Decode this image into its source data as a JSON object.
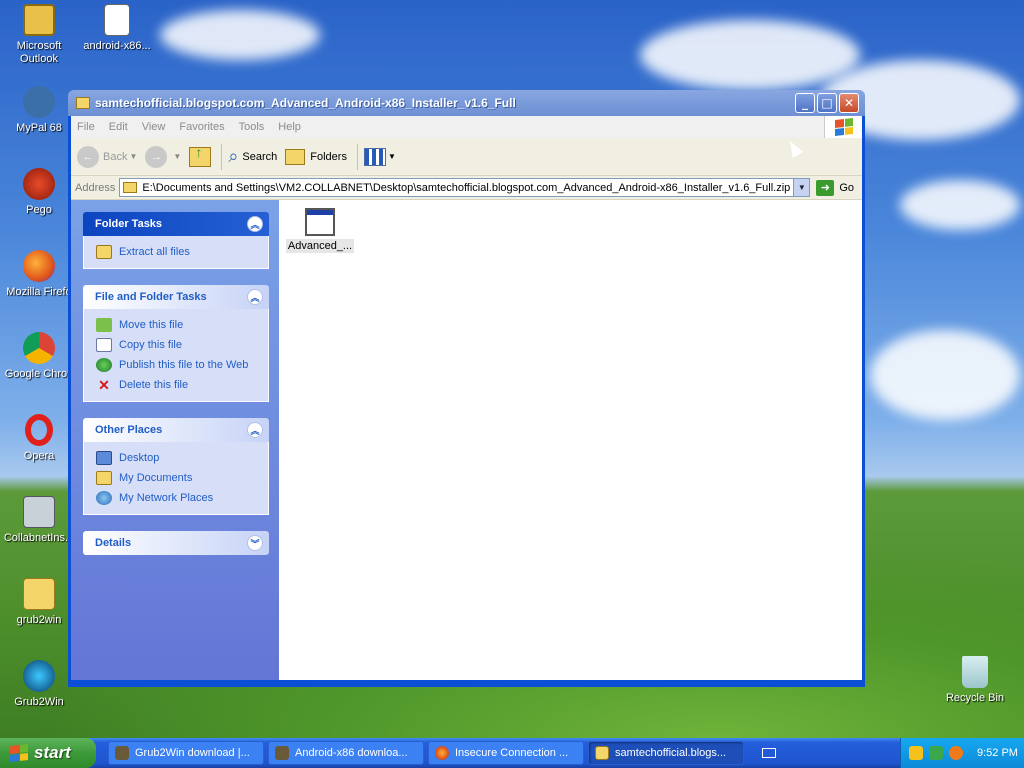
{
  "desktop": {
    "icons": [
      {
        "label": "Microsoft Outlook",
        "icon": "outlook-icon"
      },
      {
        "label": "android-x86...",
        "icon": "document-icon"
      },
      {
        "label": "MyPal 68",
        "icon": "mypal-icon"
      },
      {
        "label": "Pego",
        "icon": "pego-icon"
      },
      {
        "label": "Mozilla Firefo",
        "icon": "firefox-icon"
      },
      {
        "label": "Google Chron",
        "icon": "chrome-icon"
      },
      {
        "label": "Opera",
        "icon": "opera-icon"
      },
      {
        "label": "CollabnetIns...",
        "icon": "installer-icon"
      },
      {
        "label": "grub2win",
        "icon": "zip-folder-icon"
      },
      {
        "label": "Grub2Win",
        "icon": "grub2win-icon"
      },
      {
        "label": "Recycle Bin",
        "icon": "recycle-bin-icon"
      }
    ]
  },
  "window": {
    "title": "samtechofficial.blogspot.com_Advanced_Android-x86_Installer_v1.6_Full",
    "menu": [
      "File",
      "Edit",
      "View",
      "Favorites",
      "Tools",
      "Help"
    ],
    "toolbar": {
      "back": "Back",
      "search": "Search",
      "folders": "Folders"
    },
    "address": {
      "label": "Address",
      "value": "E:\\Documents and Settings\\VM2.COLLABNET\\Desktop\\samtechofficial.blogspot.com_Advanced_Android-x86_Installer_v1.6_Full.zip",
      "go": "Go"
    },
    "panels": {
      "folder_tasks": {
        "title": "Folder Tasks",
        "items": [
          {
            "label": "Extract all files"
          }
        ]
      },
      "file_folder_tasks": {
        "title": "File and Folder Tasks",
        "items": [
          {
            "label": "Move this file"
          },
          {
            "label": "Copy this file"
          },
          {
            "label": "Publish this file to the Web"
          },
          {
            "label": "Delete this file"
          }
        ]
      },
      "other_places": {
        "title": "Other Places",
        "items": [
          {
            "label": "Desktop"
          },
          {
            "label": "My Documents"
          },
          {
            "label": "My Network Places"
          }
        ]
      },
      "details": {
        "title": "Details"
      }
    },
    "files": [
      {
        "name": "Advanced_..."
      }
    ]
  },
  "taskbar": {
    "start": "start",
    "tasks": [
      {
        "label": "Grub2Win download |...",
        "active": false
      },
      {
        "label": "Android-x86 downloa...",
        "active": false
      },
      {
        "label": "Insecure Connection ...",
        "active": false
      },
      {
        "label": "samtechofficial.blogs...",
        "active": true
      }
    ],
    "clock": "9:52 PM"
  },
  "colors": {
    "link_blue": "#215dc6",
    "titlebar": "#7b9ddc",
    "task_pane": "#6f8de0"
  }
}
